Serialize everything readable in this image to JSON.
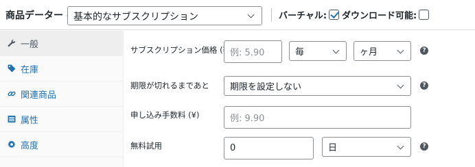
{
  "header": {
    "title": "商品データー —",
    "product_type": "基本的なサブスクリプション",
    "virtual_label": "バーチャル:",
    "virtual_checked": true,
    "downloadable_label": "ダウンロード可能:",
    "downloadable_checked": false
  },
  "sidebar": {
    "items": [
      {
        "label": "一般",
        "icon": "wrench-icon",
        "active": true
      },
      {
        "label": "在庫",
        "icon": "tag-icon",
        "active": false
      },
      {
        "label": "関連商品",
        "icon": "link-icon",
        "active": false
      },
      {
        "label": "属性",
        "icon": "list-icon",
        "active": false
      },
      {
        "label": "高度",
        "icon": "gear-icon",
        "active": false
      }
    ]
  },
  "fields": {
    "price": {
      "label": "サブスクリプション価格 (¥)",
      "placeholder": "例: 5.90",
      "interval": "毎",
      "period": "ヶ月"
    },
    "expire": {
      "label": "期限が切れるまであと",
      "value": "期限を設定しない"
    },
    "signup_fee": {
      "label": "申し込み手数料 (¥)",
      "placeholder": "例: 9.90"
    },
    "trial": {
      "label": "無料試用",
      "value": "0",
      "period": "日"
    }
  },
  "colors": {
    "accent": "#2271b1",
    "border": "#8c8f94",
    "sidebar_bg": "#fafafa"
  }
}
